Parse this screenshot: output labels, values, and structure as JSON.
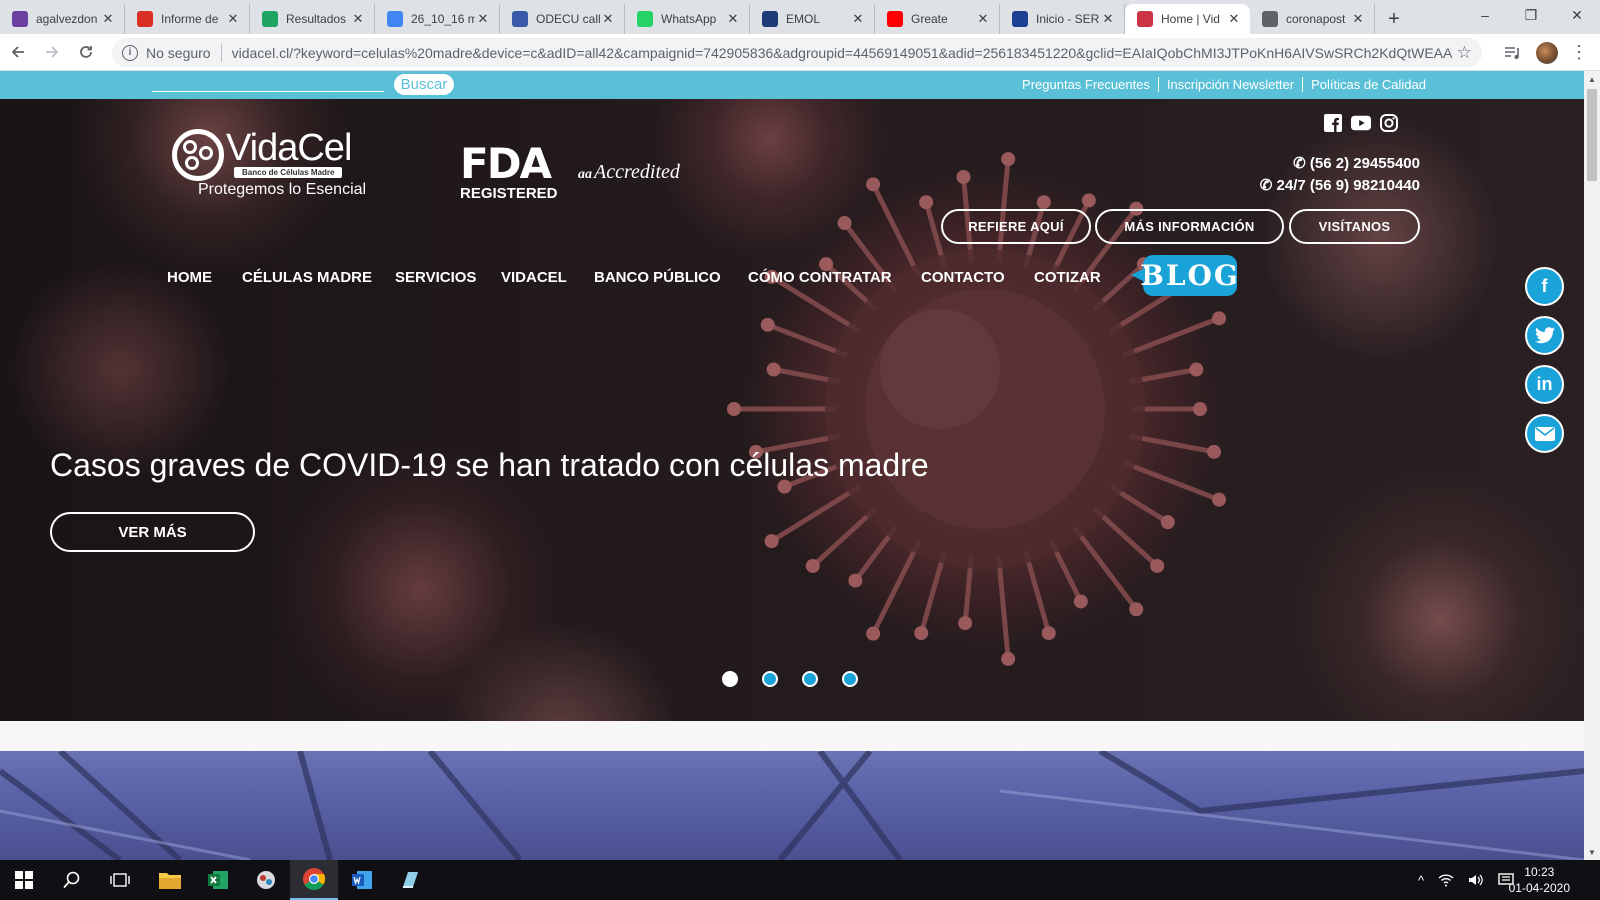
{
  "browser": {
    "tabs": [
      {
        "title": "agalvezdon",
        "icon": "mail-icon",
        "color": "#6b3fa0"
      },
      {
        "title": "Informe de",
        "icon": "gmail-icon",
        "color": "#d93025"
      },
      {
        "title": "Resultados",
        "icon": "drive-icon",
        "color": "#1fa463"
      },
      {
        "title": "26_10_16 m",
        "icon": "docs-icon",
        "color": "#4285f4"
      },
      {
        "title": "ODECU call",
        "icon": "site-icon",
        "color": "#3b5ba9"
      },
      {
        "title": "WhatsApp",
        "icon": "whatsapp-icon",
        "color": "#25d366"
      },
      {
        "title": "EMOL",
        "icon": "emol-icon",
        "color": "#1e3d78"
      },
      {
        "title": "Greate",
        "icon": "youtube-icon",
        "color": "#ff0000"
      },
      {
        "title": "Inicio - SER",
        "icon": "flag-icon",
        "color": "#1c3f94"
      },
      {
        "title": "Home | Vid",
        "icon": "vidacel-icon",
        "color": "#cc3344"
      },
      {
        "title": "coronapost",
        "icon": "globe-icon",
        "color": "#5f6368"
      }
    ],
    "active_tab": 9,
    "new_tab": "+",
    "window_controls": {
      "minimize": "–",
      "restore": "❐",
      "close": "✕"
    },
    "not_secure": "No seguro",
    "url": "vidacel.cl/?keyword=celulas%20madre&device=c&adID=all42&campaignid=742905836&adgroupid=44569149051&adid=256183451220&gclid=EAIaIQobChMI3JTPoKnH6AIVSwSRCh2KdQtWEAAY..."
  },
  "site": {
    "search_button": "Buscar",
    "top_links": [
      "Preguntas Frecuentes",
      "Inscripción Newsletter",
      "Políticas de Calidad"
    ],
    "logo_brand": "VidaCel",
    "logo_sub": "Banco de Células Madre",
    "logo_slogan": "Protegemos lo Esencial",
    "fda_big": "FDA",
    "fda_reg": "REGISTERED",
    "accredited": "Accredited",
    "phones": [
      "(56 2) 29455400",
      "24/7 (56 9) 98210440"
    ],
    "ctas": [
      "REFIERE AQUÍ",
      "MÁS INFORMACIÓN",
      "VISÍTANOS"
    ],
    "nav": [
      "HOME",
      "CÉLULAS MADRE",
      "SERVICIOS",
      "VIDACEL",
      "BANCO PÚBLICO",
      "CÓMO CONTRATAR",
      "CONTACTO",
      "COTIZAR"
    ],
    "blog": "BLOG",
    "headline": "Casos graves de COVID-19 se han tratado con células madre",
    "ver_mas": "VER MÁS",
    "slider_dots": 4,
    "active_dot": 0,
    "accent_color": "#5ac0d8",
    "blue": "#1aa3d9"
  },
  "taskbar": {
    "time": "10:23",
    "date": "01-04-2020"
  }
}
